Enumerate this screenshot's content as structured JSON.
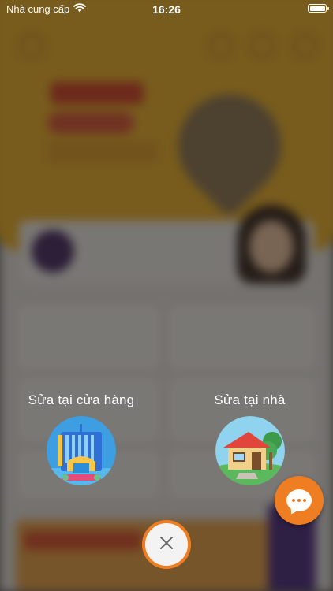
{
  "status_bar": {
    "carrier": "Nhà cung cấp",
    "time": "16:26",
    "wifi_icon": "wifi-icon",
    "battery_icon": "battery-icon",
    "battery_level": 1.0
  },
  "options": [
    {
      "label": "Sửa tại cửa hàng",
      "icon": "store-building-icon"
    },
    {
      "label": "Sửa tại nhà",
      "icon": "house-icon"
    }
  ],
  "buttons": {
    "chat_icon": "chat-bubble-icon",
    "close_icon": "close-icon",
    "accent_color": "#ef7d22"
  },
  "colors": {
    "overlay": "rgba(20,18,16,0.55)",
    "banner": "#f1b52d",
    "accent": "#ef7d22"
  }
}
